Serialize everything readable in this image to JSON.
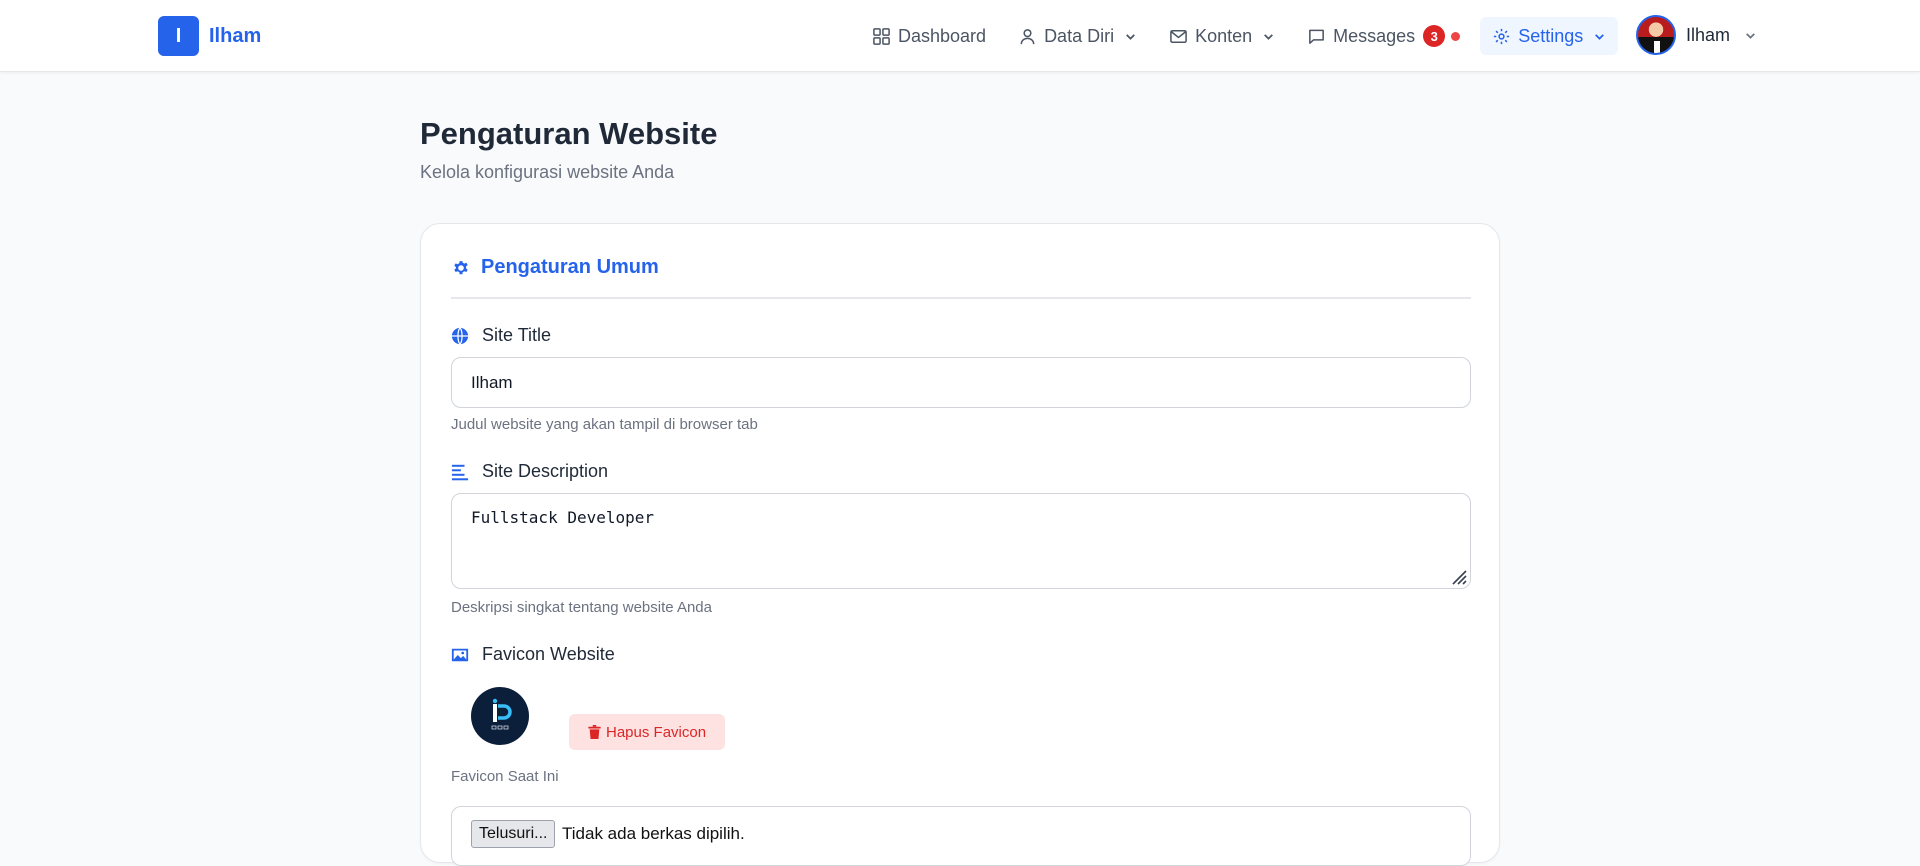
{
  "brand": {
    "initial": "I",
    "name": "Ilham"
  },
  "nav": {
    "items": [
      {
        "label": "Dashboard",
        "icon": "grid-icon",
        "has_chevron": false
      },
      {
        "label": "Data Diri",
        "icon": "user-icon",
        "has_chevron": true
      },
      {
        "label": "Konten",
        "icon": "mail-icon",
        "has_chevron": true
      },
      {
        "label": "Messages",
        "icon": "chat-icon",
        "has_chevron": false,
        "badge": "3"
      },
      {
        "label": "Settings",
        "icon": "settings-icon",
        "has_chevron": true,
        "active": true
      }
    ]
  },
  "user": {
    "name": "Ilham"
  },
  "page": {
    "title": "Pengaturan Website",
    "subtitle": "Kelola konfigurasi website Anda"
  },
  "section": {
    "title": "Pengaturan Umum",
    "icon": "gear-icon"
  },
  "site_title": {
    "label": "Site Title",
    "icon": "globe-icon",
    "value": "Ilham",
    "help": "Judul website yang akan tampil di browser tab"
  },
  "site_description": {
    "label": "Site Description",
    "icon": "align-left-icon",
    "value": "Fullstack Developer",
    "help": "Deskripsi singkat tentang website Anda"
  },
  "favicon": {
    "label": "Favicon Website",
    "icon": "image-icon",
    "delete_label": "Hapus Favicon",
    "current_caption": "Favicon Saat Ini",
    "browse_label": "Telusuri...",
    "file_status": "Tidak ada berkas dipilih."
  },
  "colors": {
    "accent": "#2563eb",
    "danger": "#dc2626",
    "danger_bg": "#fee2e2",
    "background": "#f9fafb"
  }
}
